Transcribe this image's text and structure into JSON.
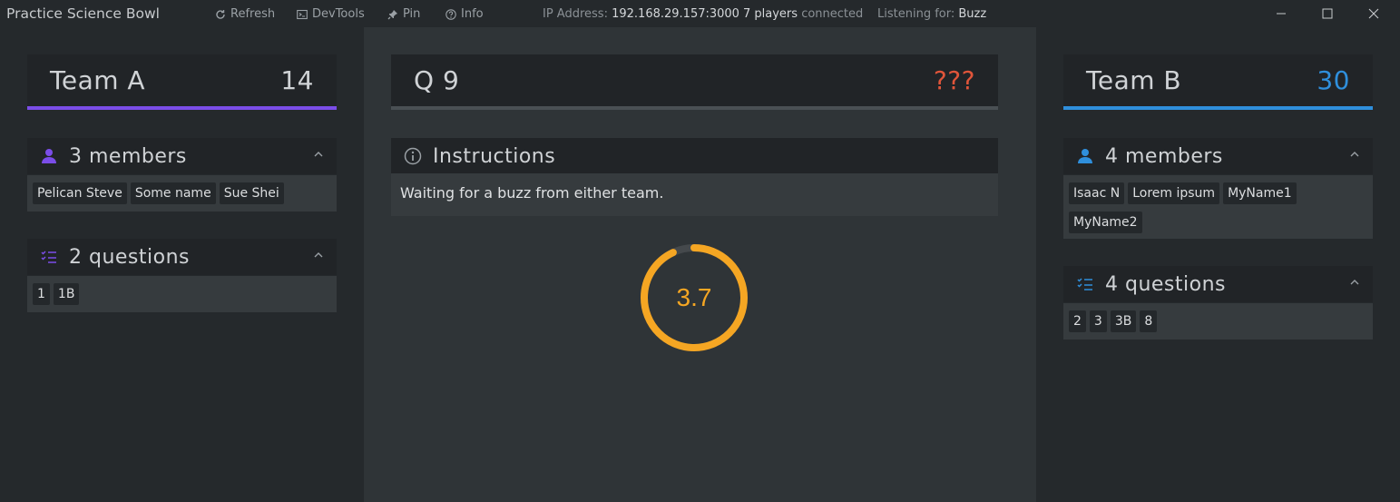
{
  "app": {
    "title": "Practice Science Bowl"
  },
  "toolbar": {
    "refresh_label": "Refresh",
    "devtools_label": "DevTools",
    "pin_label": "Pin",
    "info_label": "Info",
    "ip_label": "IP Address:",
    "ip_value": "192.168.29.157:3000",
    "players_count": "7 players",
    "players_suffix": "connected",
    "listening_label": "Listening for:",
    "listening_value": "Buzz"
  },
  "team_a": {
    "name": "Team A",
    "score": "14",
    "color": "#7b4de8",
    "members_title": "3 members",
    "members": [
      "Pelican Steve",
      "Some name",
      "Sue Shei"
    ],
    "questions_title": "2 questions",
    "questions": [
      "1",
      "1B"
    ]
  },
  "question": {
    "label": "Q 9",
    "status": "???",
    "status_color": "#e0553a",
    "instructions_title": "Instructions",
    "instructions_text": "Waiting for a buzz from either team.",
    "timer_value": "3.7",
    "timer_fraction": 0.93,
    "timer_color": "#f5a623"
  },
  "team_b": {
    "name": "Team B",
    "score": "30",
    "color": "#2f8fdc",
    "members_title": "4 members",
    "members": [
      "Isaac N",
      "Lorem ipsum",
      "MyName1",
      "MyName2"
    ],
    "questions_title": "4 questions",
    "questions": [
      "2",
      "3",
      "3B",
      "8"
    ]
  }
}
